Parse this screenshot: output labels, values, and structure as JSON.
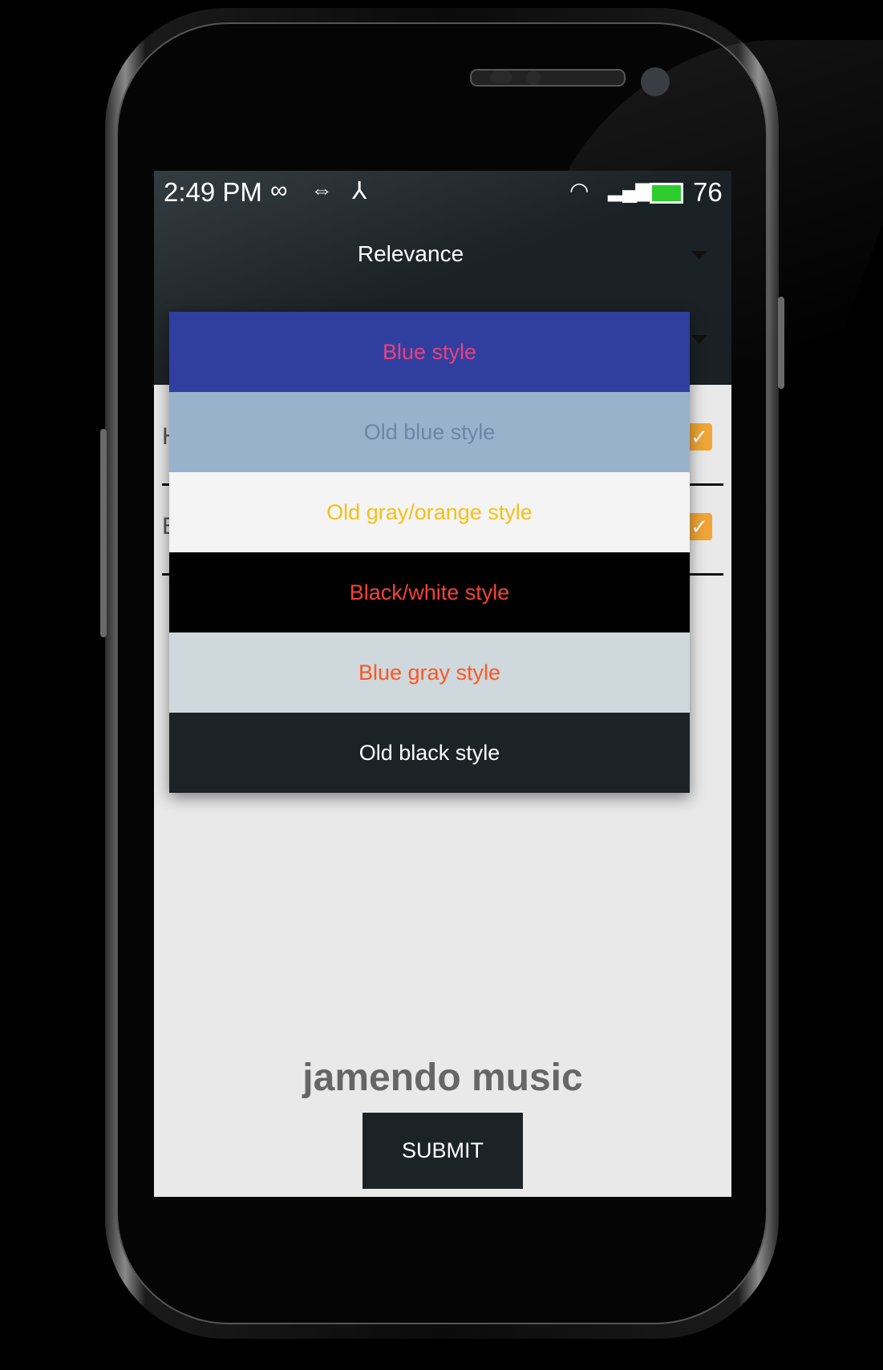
{
  "status_bar": {
    "time": "2:49 PM",
    "battery_level": "76",
    "icons": [
      "infinity-icon",
      "usb-icon",
      "share-icon",
      "wifi-icon",
      "signal-3g-icon",
      "battery-charging-icon"
    ]
  },
  "header": {
    "sort_value": "Relevance"
  },
  "settings_rows": [
    {
      "label": "H",
      "checked": true
    },
    {
      "label": "E",
      "checked": true
    }
  ],
  "dropdown": {
    "options": [
      {
        "label": "Blue style",
        "bg": "#303f9f",
        "fg": "#ec407a"
      },
      {
        "label": "Old blue style",
        "bg": "#98b2cc",
        "fg": "#6b85a6"
      },
      {
        "label": "Old gray/orange style",
        "bg": "#f4f4f4",
        "fg": "#f5c017"
      },
      {
        "label": "Black/white style",
        "bg": "#000000",
        "fg": "#f44336"
      },
      {
        "label": "Blue gray style",
        "bg": "#cfd8dc",
        "fg": "#ff5722"
      },
      {
        "label": "Old black style",
        "bg": "#1b2326",
        "fg": "#ffffff"
      }
    ]
  },
  "brand": "jamendo music",
  "submit_label": "SUBMIT"
}
